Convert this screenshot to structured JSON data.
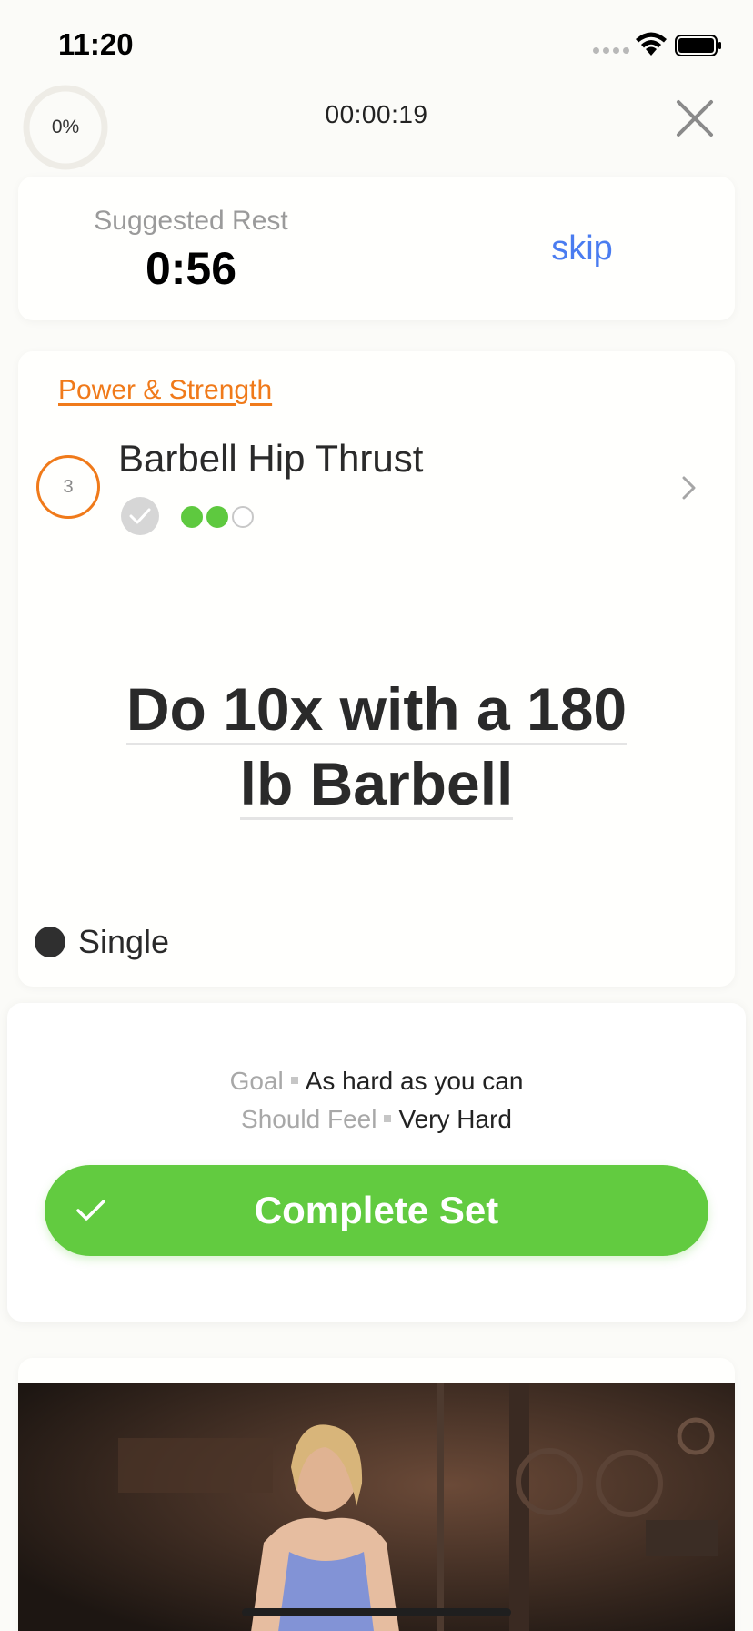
{
  "status_bar": {
    "time": "11:20"
  },
  "header": {
    "progress": "0%",
    "elapsed": "00:00:19"
  },
  "rest": {
    "label": "Suggested Rest",
    "value": "0:56",
    "skip_label": "skip"
  },
  "exercise": {
    "category": "Power & Strength",
    "set_number": "3",
    "name": "Barbell Hip Thrust",
    "sets_completed": 2,
    "sets_total": 3,
    "instruction_line1": "Do 10x  with a 180",
    "instruction_line2": "lb Barbell",
    "mode": "Single"
  },
  "goal": {
    "goal_label": "Goal",
    "goal_value": "As hard as you can",
    "feel_label": "Should Feel",
    "feel_value": "Very Hard"
  },
  "complete_button": {
    "label": "Complete Set"
  },
  "colors": {
    "accent": "#62cb40",
    "category": "#f07a1a",
    "link": "#4a7cf0"
  },
  "icons": [
    "wifi-icon",
    "battery-icon",
    "close-icon",
    "checkmark-icon",
    "chevron-right-icon"
  ]
}
